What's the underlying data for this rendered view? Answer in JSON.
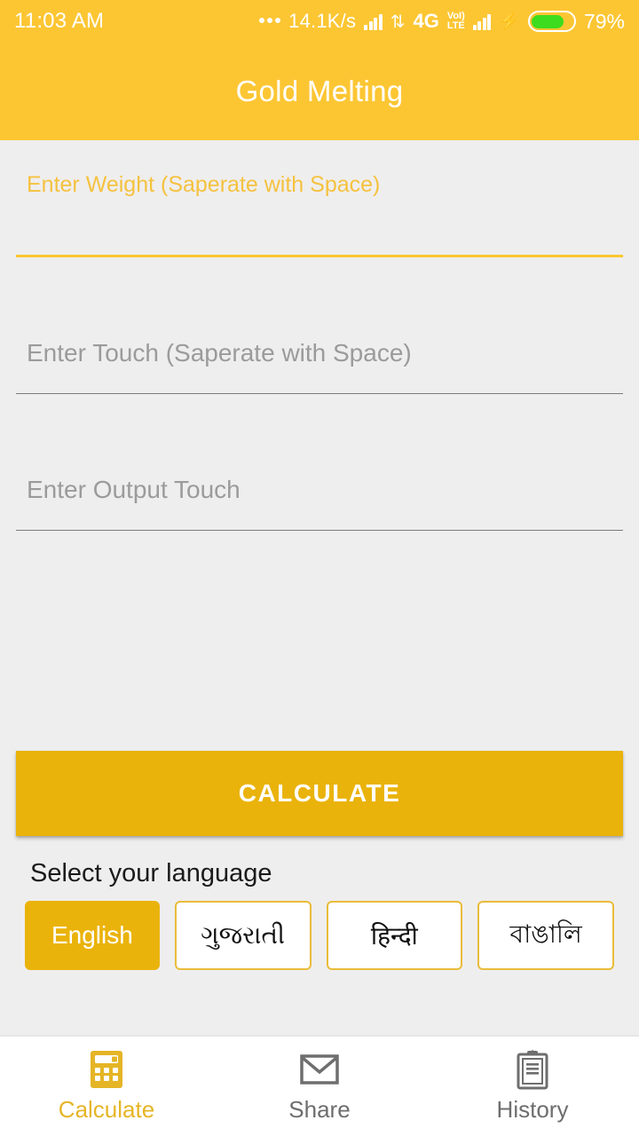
{
  "theme": {
    "appbar_color": "#FCC633",
    "accent_color": "#EAB30B",
    "page_background": "#EFEEEE",
    "active_nav_color": "#E5B526",
    "inactive_nav_color": "#6E6E6E",
    "battery_fill_color": "#3DDC1E"
  },
  "status_bar": {
    "time": "11:03 AM",
    "overflow_dots_icon": "more-dots-icon",
    "network_speed": "14.1K/s",
    "signal_icon_1": "signal-bars-icon",
    "sync_icon": "data-transfer-icon",
    "network_type": "4G",
    "volte_top": "VoI)",
    "volte_bottom": "LTE",
    "signal_icon_2": "signal-bars-icon",
    "charging_icon": "lightning-bolt-icon",
    "battery_icon": "battery-icon",
    "battery_percent": "79%",
    "battery_level": 79
  },
  "app_bar": {
    "title": "Gold Melting"
  },
  "form": {
    "weight_field": {
      "label": "Enter Weight (Saperate with Space)",
      "value": "",
      "focused": true
    },
    "touch_field": {
      "placeholder": "Enter Touch (Saperate with Space)",
      "value": ""
    },
    "output_touch_field": {
      "placeholder": "Enter Output Touch",
      "value": ""
    }
  },
  "calculate_button": {
    "label": "CALCULATE"
  },
  "language_section": {
    "title": "Select your language",
    "options": [
      {
        "label": "English",
        "selected": true
      },
      {
        "label": "ગુજરાતી",
        "selected": false
      },
      {
        "label": "हिन्दी",
        "selected": false
      },
      {
        "label": "বাঙালি",
        "selected": false
      }
    ]
  },
  "bottom_nav": {
    "items": [
      {
        "label": "Calculate",
        "icon": "calculator-icon",
        "active": true
      },
      {
        "label": "Share",
        "icon": "envelope-icon",
        "active": false
      },
      {
        "label": "History",
        "icon": "clipboard-icon",
        "active": false
      }
    ]
  }
}
